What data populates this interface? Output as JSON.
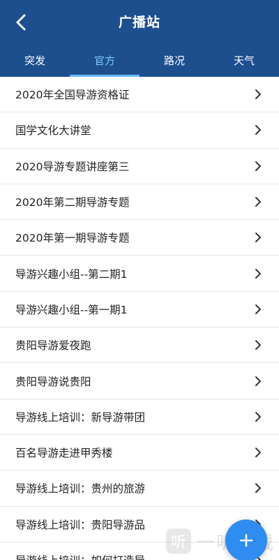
{
  "header": {
    "title": "广播站",
    "back_icon": "chevron-left-icon"
  },
  "tabs": [
    {
      "label": "突发",
      "active": false
    },
    {
      "label": "官方",
      "active": true
    },
    {
      "label": "路况",
      "active": false
    },
    {
      "label": "天气",
      "active": false
    }
  ],
  "list": {
    "items": [
      {
        "label": "2020年全国导游资格证"
      },
      {
        "label": "国学文化大讲堂"
      },
      {
        "label": "2020导游专题讲座第三"
      },
      {
        "label": "2020年第二期导游专题"
      },
      {
        "label": "2020年第一期导游专题"
      },
      {
        "label": "导游兴趣小组--第二期1"
      },
      {
        "label": "导游兴趣小组--第一期1"
      },
      {
        "label": "贵阳导游爱夜跑"
      },
      {
        "label": "贵阳导游说贵阳"
      },
      {
        "label": "导游线上培训：新导游带团"
      },
      {
        "label": "百名导游走进甲秀楼"
      },
      {
        "label": "导游线上培训：贵州的旅游"
      },
      {
        "label": "导游线上培训：贵阳导游品"
      },
      {
        "label": "导游线上培训：如何打造导"
      }
    ]
  },
  "fab": {
    "icon": "plus-icon",
    "label": "+"
  },
  "watermark": {
    "logo_text": "听",
    "text": "一听下载"
  },
  "colors": {
    "header": "#1d4f8f",
    "active_tab": "#7fc8ff",
    "fab": "#2f8cf0"
  }
}
